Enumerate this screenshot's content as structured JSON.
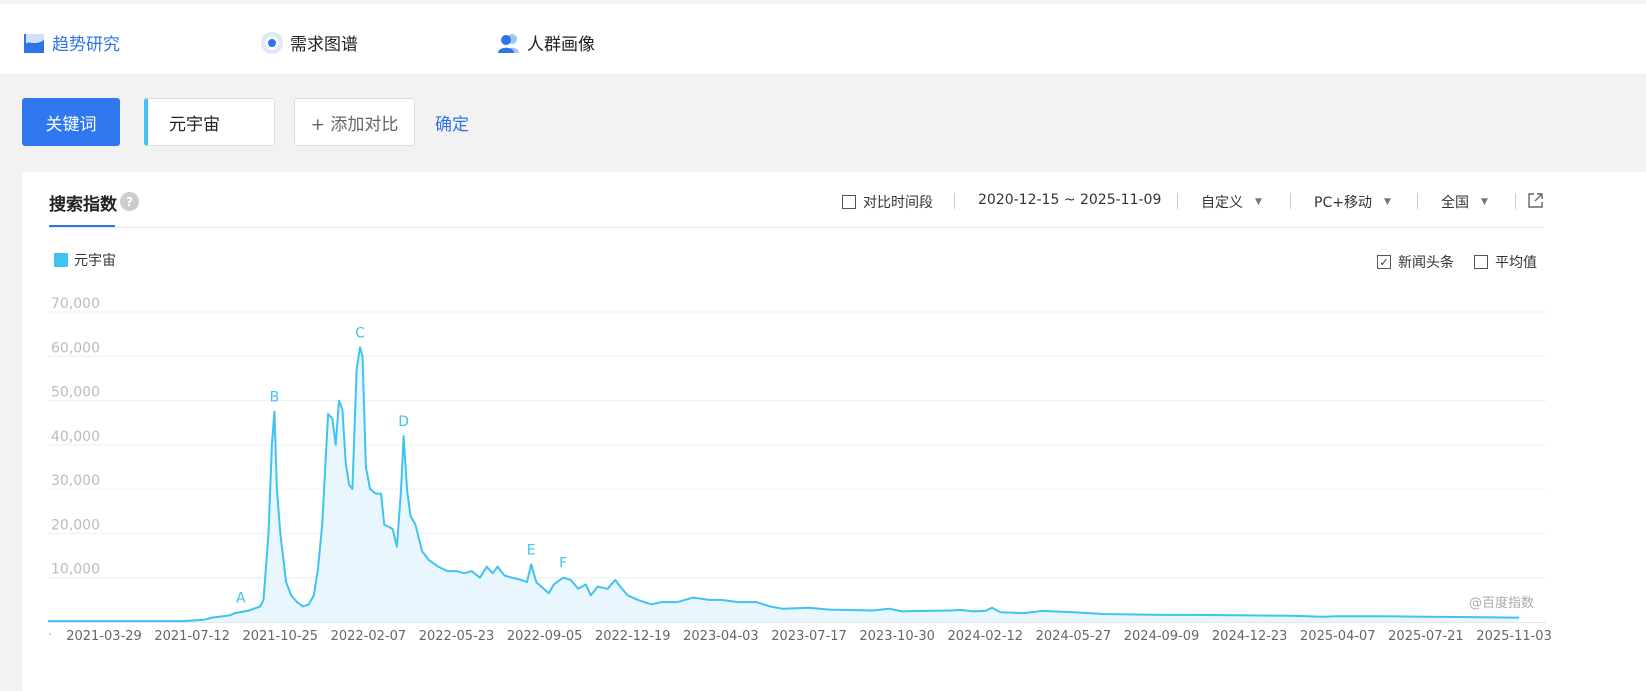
{
  "nav": {
    "trend": "趋势研究",
    "demand": "需求图谱",
    "crowd": "人群画像"
  },
  "toolbar": {
    "keyword_button": "关键词",
    "keyword_value": "元宇宙",
    "add_compare": "+ 添加对比",
    "confirm": "确定"
  },
  "panel": {
    "title": "搜索指数",
    "help": "?",
    "compare_period": "对比时间段",
    "date_range": "2020-12-15 ~ 2025-11-09",
    "custom": "自定义",
    "device": "PC+移动",
    "region": "全国",
    "legend": "元宇宙",
    "news_headline": "新闻头条",
    "news_checked": true,
    "average": "平均值",
    "average_checked": false,
    "watermark": "@百度指数"
  },
  "colors": {
    "accent": "#2f78f0",
    "series": "#3fc3f0",
    "area_fill": "#eaf6fd"
  },
  "chart_data": {
    "type": "area",
    "title": "搜索指数",
    "series_name": "元宇宙",
    "ylim": [
      0,
      70000
    ],
    "y_ticks": [
      "70,000",
      "60,000",
      "50,000",
      "40,000",
      "30,000",
      "20,000",
      "10,000"
    ],
    "x_ticks": [
      "2021-03-29",
      "2021-07-12",
      "2021-10-25",
      "2022-02-07",
      "2022-05-23",
      "2022-09-05",
      "2022-12-19",
      "2023-04-03",
      "2023-07-17",
      "2023-10-30",
      "2024-02-12",
      "2024-05-27",
      "2024-09-09",
      "2024-12-23",
      "2025-04-07",
      "2025-07-21",
      "2025-11-03"
    ],
    "x_range": [
      "2020-12-15",
      "2025-11-09"
    ],
    "grid": true,
    "legend_position": "top-left",
    "points": [
      [
        "2020-12-15",
        200
      ],
      [
        "2021-03-01",
        200
      ],
      [
        "2021-06-01",
        200
      ],
      [
        "2021-07-01",
        200
      ],
      [
        "2021-07-26",
        500
      ],
      [
        "2021-08-05",
        1000
      ],
      [
        "2021-08-26",
        1500
      ],
      [
        "2021-09-01",
        2000
      ],
      [
        "2021-09-16",
        2500
      ],
      [
        "2021-10-01",
        3500
      ],
      [
        "2021-10-05",
        5000
      ],
      [
        "2021-10-11",
        20000
      ],
      [
        "2021-10-15",
        40000
      ],
      [
        "2021-10-18",
        47500
      ],
      [
        "2021-10-21",
        30000
      ],
      [
        "2021-10-25",
        20000
      ],
      [
        "2021-11-01",
        9000
      ],
      [
        "2021-11-07",
        6000
      ],
      [
        "2021-11-14",
        4500
      ],
      [
        "2021-11-21",
        3500
      ],
      [
        "2021-11-28",
        4000
      ],
      [
        "2021-12-04",
        6000
      ],
      [
        "2021-12-09",
        12000
      ],
      [
        "2021-12-14",
        22000
      ],
      [
        "2021-12-21",
        47000
      ],
      [
        "2021-12-26",
        46000
      ],
      [
        "2021-12-30",
        40000
      ],
      [
        "2022-01-03",
        50000
      ],
      [
        "2022-01-07",
        48000
      ],
      [
        "2022-01-11",
        36000
      ],
      [
        "2022-01-15",
        31000
      ],
      [
        "2022-01-19",
        30000
      ],
      [
        "2022-01-24",
        57000
      ],
      [
        "2022-01-28",
        62000
      ],
      [
        "2022-01-31",
        60000
      ],
      [
        "2022-02-04",
        35000
      ],
      [
        "2022-02-09",
        30000
      ],
      [
        "2022-02-16",
        29000
      ],
      [
        "2022-02-22",
        29000
      ],
      [
        "2022-02-26",
        22000
      ],
      [
        "2022-03-08",
        21000
      ],
      [
        "2022-03-13",
        17000
      ],
      [
        "2022-03-18",
        30000
      ],
      [
        "2022-03-21",
        42000
      ],
      [
        "2022-03-25",
        30000
      ],
      [
        "2022-03-29",
        24000
      ],
      [
        "2022-04-04",
        22000
      ],
      [
        "2022-04-12",
        16000
      ],
      [
        "2022-04-20",
        14000
      ],
      [
        "2022-05-01",
        12500
      ],
      [
        "2022-05-12",
        11500
      ],
      [
        "2022-05-23",
        11500
      ],
      [
        "2022-06-01",
        11000
      ],
      [
        "2022-06-10",
        11500
      ],
      [
        "2022-06-20",
        10000
      ],
      [
        "2022-06-28",
        12500
      ],
      [
        "2022-07-05",
        11000
      ],
      [
        "2022-07-11",
        12500
      ],
      [
        "2022-07-19",
        10500
      ],
      [
        "2022-07-28",
        10000
      ],
      [
        "2022-08-08",
        9500
      ],
      [
        "2022-08-15",
        9000
      ],
      [
        "2022-08-20",
        13000
      ],
      [
        "2022-08-26",
        9000
      ],
      [
        "2022-09-01",
        8000
      ],
      [
        "2022-09-10",
        6500
      ],
      [
        "2022-09-16",
        8500
      ],
      [
        "2022-09-27",
        10000
      ],
      [
        "2022-10-06",
        9500
      ],
      [
        "2022-10-15",
        7500
      ],
      [
        "2022-10-24",
        8500
      ],
      [
        "2022-10-30",
        6000
      ],
      [
        "2022-11-07",
        8000
      ],
      [
        "2022-11-19",
        7500
      ],
      [
        "2022-11-28",
        9500
      ],
      [
        "2022-12-04",
        8000
      ],
      [
        "2022-12-13",
        6000
      ],
      [
        "2022-12-25",
        5000
      ],
      [
        "2023-01-10",
        4000
      ],
      [
        "2023-01-22",
        4500
      ],
      [
        "2023-02-10",
        4500
      ],
      [
        "2023-03-01",
        5500
      ],
      [
        "2023-03-20",
        5000
      ],
      [
        "2023-04-03",
        5000
      ],
      [
        "2023-04-24",
        4500
      ],
      [
        "2023-05-15",
        4500
      ],
      [
        "2023-06-01",
        3500
      ],
      [
        "2023-06-15",
        3000
      ],
      [
        "2023-07-17",
        3200
      ],
      [
        "2023-08-10",
        2800
      ],
      [
        "2023-09-05",
        2700
      ],
      [
        "2023-10-01",
        2600
      ],
      [
        "2023-10-20",
        3000
      ],
      [
        "2023-11-05",
        2400
      ],
      [
        "2023-12-01",
        2500
      ],
      [
        "2024-01-01",
        2600
      ],
      [
        "2024-01-15",
        2700
      ],
      [
        "2024-01-28",
        2400
      ],
      [
        "2024-02-12",
        2500
      ],
      [
        "2024-02-20",
        3200
      ],
      [
        "2024-03-01",
        2200
      ],
      [
        "2024-03-30",
        2000
      ],
      [
        "2024-04-20",
        2500
      ],
      [
        "2024-05-27",
        2200
      ],
      [
        "2024-07-01",
        1800
      ],
      [
        "2024-09-09",
        1600
      ],
      [
        "2024-10-15",
        1600
      ],
      [
        "2024-12-23",
        1500
      ],
      [
        "2025-02-10",
        1400
      ],
      [
        "2025-03-20",
        1200
      ],
      [
        "2025-04-07",
        1300
      ],
      [
        "2025-05-20",
        1300
      ],
      [
        "2025-07-21",
        1200
      ],
      [
        "2025-09-15",
        1100
      ],
      [
        "2025-11-03",
        1000
      ],
      [
        "2025-11-09",
        1000
      ]
    ],
    "annotations": [
      {
        "label": "A",
        "date": "2021-09-08",
        "value": 2200
      },
      {
        "label": "B",
        "date": "2021-10-18",
        "value": 47500
      },
      {
        "label": "C",
        "date": "2022-01-28",
        "value": 62000
      },
      {
        "label": "D",
        "date": "2022-03-21",
        "value": 42000
      },
      {
        "label": "E",
        "date": "2022-08-20",
        "value": 13000
      },
      {
        "label": "F",
        "date": "2022-09-27",
        "value": 10000
      }
    ]
  }
}
